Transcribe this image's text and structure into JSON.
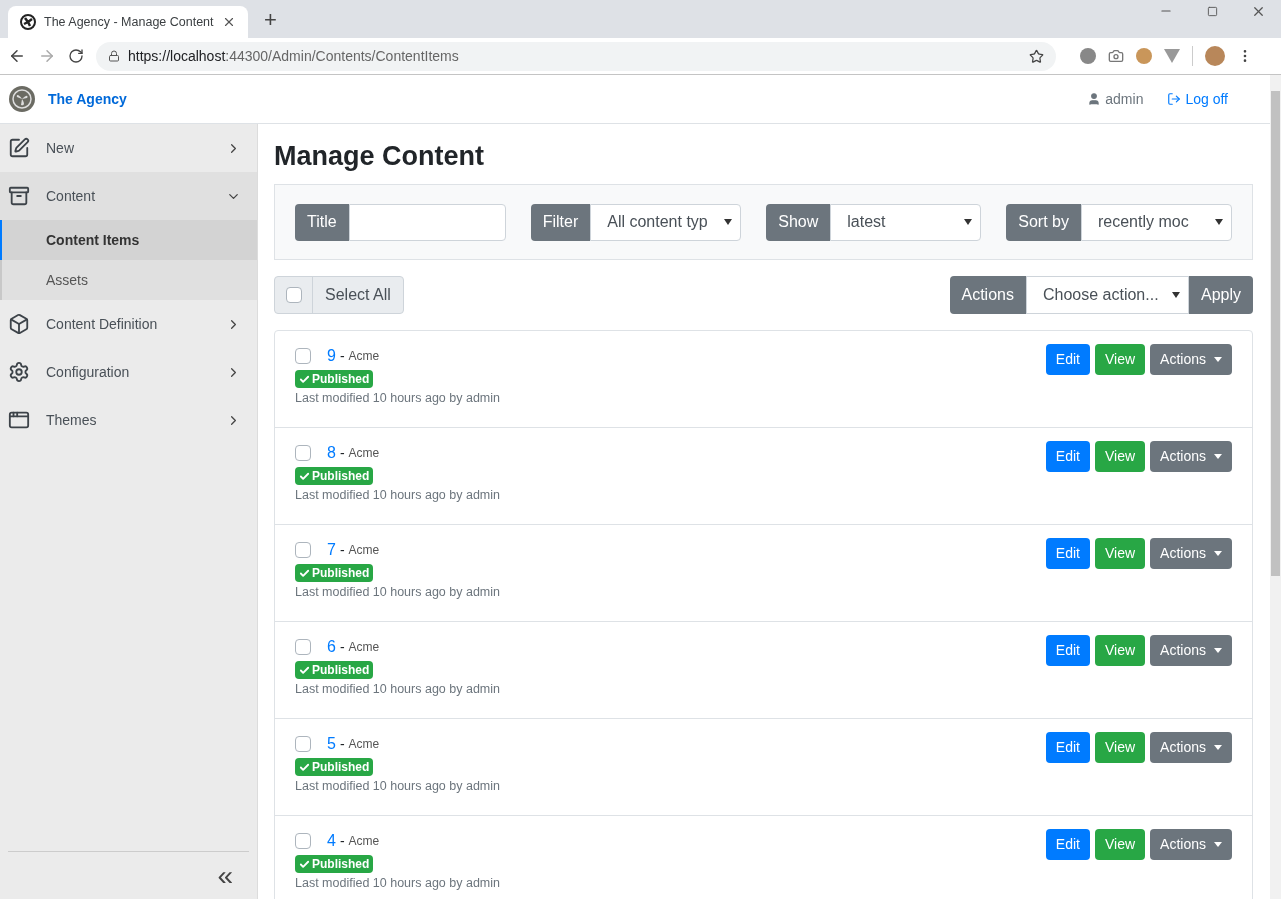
{
  "browser": {
    "tab_title": "The Agency - Manage Content",
    "new_tab": "+",
    "url_host": "https://localhost",
    "url_rest": ":44300/Admin/Contents/ContentItems"
  },
  "header": {
    "site_name": "The Agency",
    "user": "admin",
    "log_off": "Log off"
  },
  "sidebar": {
    "items": [
      {
        "label": "New",
        "expanded": false
      },
      {
        "label": "Content",
        "expanded": true,
        "children": [
          {
            "label": "Content Items",
            "selected": true
          },
          {
            "label": "Assets",
            "selected": false
          }
        ]
      },
      {
        "label": "Content Definition",
        "expanded": false
      },
      {
        "label": "Configuration",
        "expanded": false
      },
      {
        "label": "Themes",
        "expanded": false
      }
    ],
    "collapse": "«"
  },
  "page_title": "Manage Content",
  "filters": [
    {
      "kind": "text",
      "label": "Title"
    },
    {
      "kind": "select",
      "label": "Filter",
      "value": "All content typ"
    },
    {
      "kind": "select",
      "label": "Show",
      "value": "latest"
    },
    {
      "kind": "select",
      "label": "Sort by",
      "value": "recently moc"
    }
  ],
  "bulk": {
    "select_all": "Select All",
    "checked": false,
    "actions_label": "Actions",
    "actions_value": "Choose action...",
    "apply": "Apply"
  },
  "items": [
    {
      "number": "9",
      "separator": "-",
      "type": "Acme",
      "published": true,
      "status": "Published",
      "modified": "Last modified 10 hours ago by admin",
      "checked": false,
      "edit": "Edit",
      "view": "View",
      "actions": "Actions"
    },
    {
      "number": "8",
      "separator": "-",
      "type": "Acme",
      "published": true,
      "status": "Published",
      "modified": "Last modified 10 hours ago by admin",
      "checked": false,
      "edit": "Edit",
      "view": "View",
      "actions": "Actions"
    },
    {
      "number": "7",
      "separator": "-",
      "type": "Acme",
      "published": true,
      "status": "Published",
      "modified": "Last modified 10 hours ago by admin",
      "checked": false,
      "edit": "Edit",
      "view": "View",
      "actions": "Actions"
    },
    {
      "number": "6",
      "separator": "-",
      "type": "Acme",
      "published": true,
      "status": "Published",
      "modified": "Last modified 10 hours ago by admin",
      "checked": false,
      "edit": "Edit",
      "view": "View",
      "actions": "Actions"
    },
    {
      "number": "5",
      "separator": "-",
      "type": "Acme",
      "published": true,
      "status": "Published",
      "modified": "Last modified 10 hours ago by admin",
      "checked": false,
      "edit": "Edit",
      "view": "View",
      "actions": "Actions"
    },
    {
      "number": "4",
      "separator": "-",
      "type": "Acme",
      "published": true,
      "status": "Published",
      "modified": "Last modified 10 hours ago by admin",
      "checked": false,
      "edit": "Edit",
      "view": "View",
      "actions": "Actions"
    }
  ]
}
